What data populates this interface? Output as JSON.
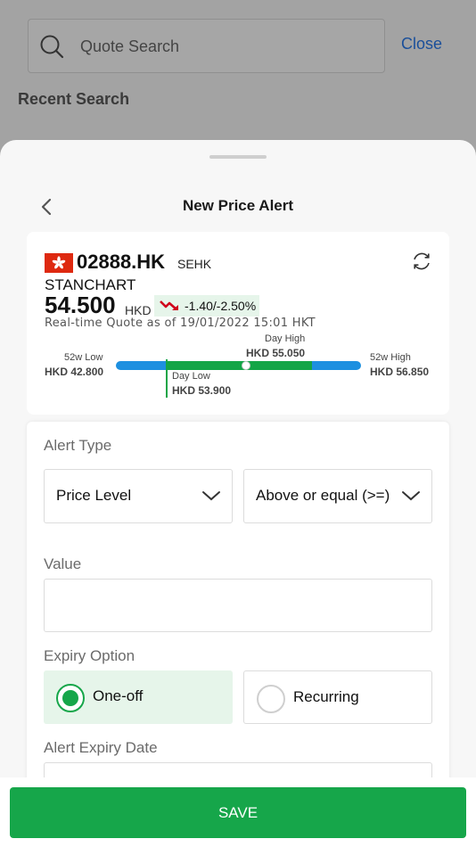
{
  "background": {
    "search_placeholder": "Quote Search",
    "close_label": "Close",
    "recent_search_label": "Recent Search"
  },
  "sheet": {
    "title": "New Price Alert"
  },
  "quote": {
    "symbol": "02888.HK",
    "exchange": "SEHK",
    "name": "STANCHART",
    "price": "54.500",
    "currency": "HKD",
    "change": "-1.40/-2.50%",
    "timestamp": "Real-time Quote as of 19/01/2022 15:01 HKT",
    "range": {
      "w52_low_label": "52w Low",
      "w52_low_value": "HKD 42.800",
      "w52_high_label": "52w High",
      "w52_high_value": "HKD 56.850",
      "day_high_label": "Day High",
      "day_high_value": "HKD 55.050",
      "day_low_label": "Day Low",
      "day_low_value": "HKD 53.900"
    }
  },
  "form": {
    "alert_type_label": "Alert Type",
    "alert_type_value": "Price Level",
    "condition_value": "Above or equal (>=)",
    "value_label": "Value",
    "value_input": "",
    "expiry_option_label": "Expiry Option",
    "option_one_off": "One-off",
    "option_recurring": "Recurring",
    "expiry_date_label": "Alert Expiry Date"
  },
  "save_label": "SAVE",
  "colors": {
    "accent_green": "#16a64a",
    "range_blue": "#1e90e0",
    "down_red": "#d0021b",
    "link_blue": "#1a4f9a"
  }
}
